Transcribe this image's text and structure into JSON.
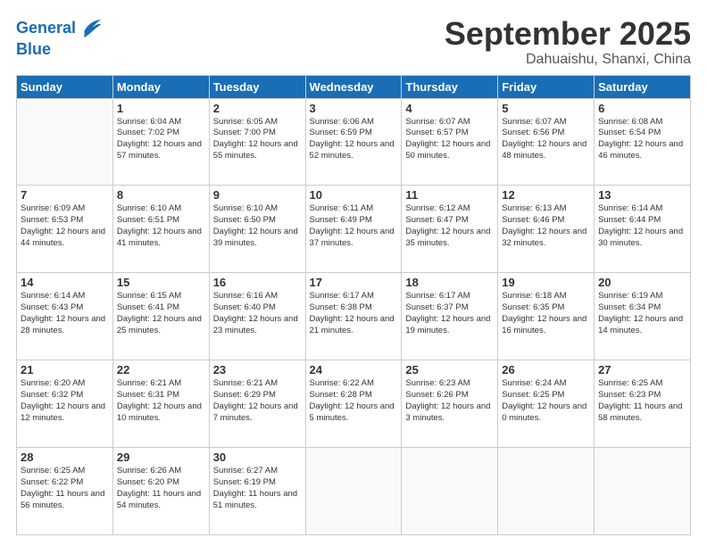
{
  "logo": {
    "line1": "General",
    "line2": "Blue"
  },
  "header": {
    "month": "September 2025",
    "location": "Dahuaishu, Shanxi, China"
  },
  "weekdays": [
    "Sunday",
    "Monday",
    "Tuesday",
    "Wednesday",
    "Thursday",
    "Friday",
    "Saturday"
  ],
  "weeks": [
    [
      {
        "day": "",
        "sunrise": "",
        "sunset": "",
        "daylight": ""
      },
      {
        "day": "1",
        "sunrise": "Sunrise: 6:04 AM",
        "sunset": "Sunset: 7:02 PM",
        "daylight": "Daylight: 12 hours and 57 minutes."
      },
      {
        "day": "2",
        "sunrise": "Sunrise: 6:05 AM",
        "sunset": "Sunset: 7:00 PM",
        "daylight": "Daylight: 12 hours and 55 minutes."
      },
      {
        "day": "3",
        "sunrise": "Sunrise: 6:06 AM",
        "sunset": "Sunset: 6:59 PM",
        "daylight": "Daylight: 12 hours and 52 minutes."
      },
      {
        "day": "4",
        "sunrise": "Sunrise: 6:07 AM",
        "sunset": "Sunset: 6:57 PM",
        "daylight": "Daylight: 12 hours and 50 minutes."
      },
      {
        "day": "5",
        "sunrise": "Sunrise: 6:07 AM",
        "sunset": "Sunset: 6:56 PM",
        "daylight": "Daylight: 12 hours and 48 minutes."
      },
      {
        "day": "6",
        "sunrise": "Sunrise: 6:08 AM",
        "sunset": "Sunset: 6:54 PM",
        "daylight": "Daylight: 12 hours and 46 minutes."
      }
    ],
    [
      {
        "day": "7",
        "sunrise": "Sunrise: 6:09 AM",
        "sunset": "Sunset: 6:53 PM",
        "daylight": "Daylight: 12 hours and 44 minutes."
      },
      {
        "day": "8",
        "sunrise": "Sunrise: 6:10 AM",
        "sunset": "Sunset: 6:51 PM",
        "daylight": "Daylight: 12 hours and 41 minutes."
      },
      {
        "day": "9",
        "sunrise": "Sunrise: 6:10 AM",
        "sunset": "Sunset: 6:50 PM",
        "daylight": "Daylight: 12 hours and 39 minutes."
      },
      {
        "day": "10",
        "sunrise": "Sunrise: 6:11 AM",
        "sunset": "Sunset: 6:49 PM",
        "daylight": "Daylight: 12 hours and 37 minutes."
      },
      {
        "day": "11",
        "sunrise": "Sunrise: 6:12 AM",
        "sunset": "Sunset: 6:47 PM",
        "daylight": "Daylight: 12 hours and 35 minutes."
      },
      {
        "day": "12",
        "sunrise": "Sunrise: 6:13 AM",
        "sunset": "Sunset: 6:46 PM",
        "daylight": "Daylight: 12 hours and 32 minutes."
      },
      {
        "day": "13",
        "sunrise": "Sunrise: 6:14 AM",
        "sunset": "Sunset: 6:44 PM",
        "daylight": "Daylight: 12 hours and 30 minutes."
      }
    ],
    [
      {
        "day": "14",
        "sunrise": "Sunrise: 6:14 AM",
        "sunset": "Sunset: 6:43 PM",
        "daylight": "Daylight: 12 hours and 28 minutes."
      },
      {
        "day": "15",
        "sunrise": "Sunrise: 6:15 AM",
        "sunset": "Sunset: 6:41 PM",
        "daylight": "Daylight: 12 hours and 25 minutes."
      },
      {
        "day": "16",
        "sunrise": "Sunrise: 6:16 AM",
        "sunset": "Sunset: 6:40 PM",
        "daylight": "Daylight: 12 hours and 23 minutes."
      },
      {
        "day": "17",
        "sunrise": "Sunrise: 6:17 AM",
        "sunset": "Sunset: 6:38 PM",
        "daylight": "Daylight: 12 hours and 21 minutes."
      },
      {
        "day": "18",
        "sunrise": "Sunrise: 6:17 AM",
        "sunset": "Sunset: 6:37 PM",
        "daylight": "Daylight: 12 hours and 19 minutes."
      },
      {
        "day": "19",
        "sunrise": "Sunrise: 6:18 AM",
        "sunset": "Sunset: 6:35 PM",
        "daylight": "Daylight: 12 hours and 16 minutes."
      },
      {
        "day": "20",
        "sunrise": "Sunrise: 6:19 AM",
        "sunset": "Sunset: 6:34 PM",
        "daylight": "Daylight: 12 hours and 14 minutes."
      }
    ],
    [
      {
        "day": "21",
        "sunrise": "Sunrise: 6:20 AM",
        "sunset": "Sunset: 6:32 PM",
        "daylight": "Daylight: 12 hours and 12 minutes."
      },
      {
        "day": "22",
        "sunrise": "Sunrise: 6:21 AM",
        "sunset": "Sunset: 6:31 PM",
        "daylight": "Daylight: 12 hours and 10 minutes."
      },
      {
        "day": "23",
        "sunrise": "Sunrise: 6:21 AM",
        "sunset": "Sunset: 6:29 PM",
        "daylight": "Daylight: 12 hours and 7 minutes."
      },
      {
        "day": "24",
        "sunrise": "Sunrise: 6:22 AM",
        "sunset": "Sunset: 6:28 PM",
        "daylight": "Daylight: 12 hours and 5 minutes."
      },
      {
        "day": "25",
        "sunrise": "Sunrise: 6:23 AM",
        "sunset": "Sunset: 6:26 PM",
        "daylight": "Daylight: 12 hours and 3 minutes."
      },
      {
        "day": "26",
        "sunrise": "Sunrise: 6:24 AM",
        "sunset": "Sunset: 6:25 PM",
        "daylight": "Daylight: 12 hours and 0 minutes."
      },
      {
        "day": "27",
        "sunrise": "Sunrise: 6:25 AM",
        "sunset": "Sunset: 6:23 PM",
        "daylight": "Daylight: 11 hours and 58 minutes."
      }
    ],
    [
      {
        "day": "28",
        "sunrise": "Sunrise: 6:25 AM",
        "sunset": "Sunset: 6:22 PM",
        "daylight": "Daylight: 11 hours and 56 minutes."
      },
      {
        "day": "29",
        "sunrise": "Sunrise: 6:26 AM",
        "sunset": "Sunset: 6:20 PM",
        "daylight": "Daylight: 11 hours and 54 minutes."
      },
      {
        "day": "30",
        "sunrise": "Sunrise: 6:27 AM",
        "sunset": "Sunset: 6:19 PM",
        "daylight": "Daylight: 11 hours and 51 minutes."
      },
      {
        "day": "",
        "sunrise": "",
        "sunset": "",
        "daylight": ""
      },
      {
        "day": "",
        "sunrise": "",
        "sunset": "",
        "daylight": ""
      },
      {
        "day": "",
        "sunrise": "",
        "sunset": "",
        "daylight": ""
      },
      {
        "day": "",
        "sunrise": "",
        "sunset": "",
        "daylight": ""
      }
    ]
  ]
}
